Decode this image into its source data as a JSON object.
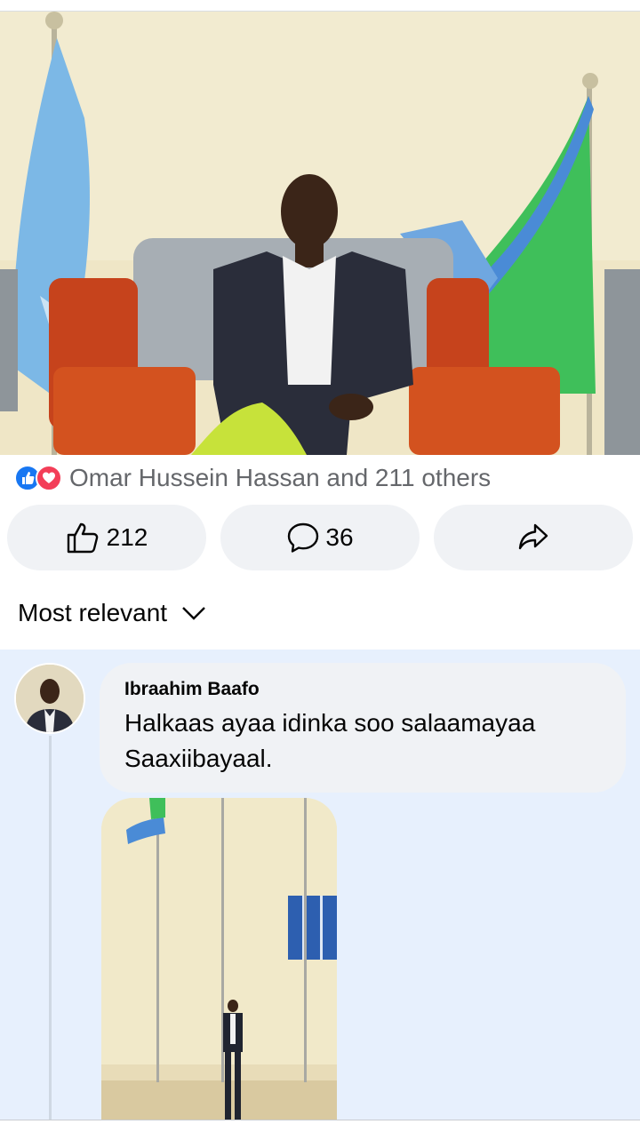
{
  "post": {
    "reactions_summary": "Omar Hussein Hassan and 211 others",
    "reaction_icons": [
      "like-icon",
      "love-icon"
    ],
    "like_count": "212",
    "comment_count": "36",
    "share_label": ""
  },
  "sort": {
    "label": "Most relevant"
  },
  "comments": [
    {
      "author": "Ibraahim Baafo",
      "text_line1": "Halkaas ayaa idinka soo salaamayaa",
      "text_line2": "Saaxiibayaal."
    }
  ],
  "colors": {
    "like_blue": "#1877f2",
    "love_red": "#f33e58",
    "button_bg": "#f0f2f5",
    "comments_bg": "#e7f0fd",
    "muted_text": "#65676b"
  }
}
